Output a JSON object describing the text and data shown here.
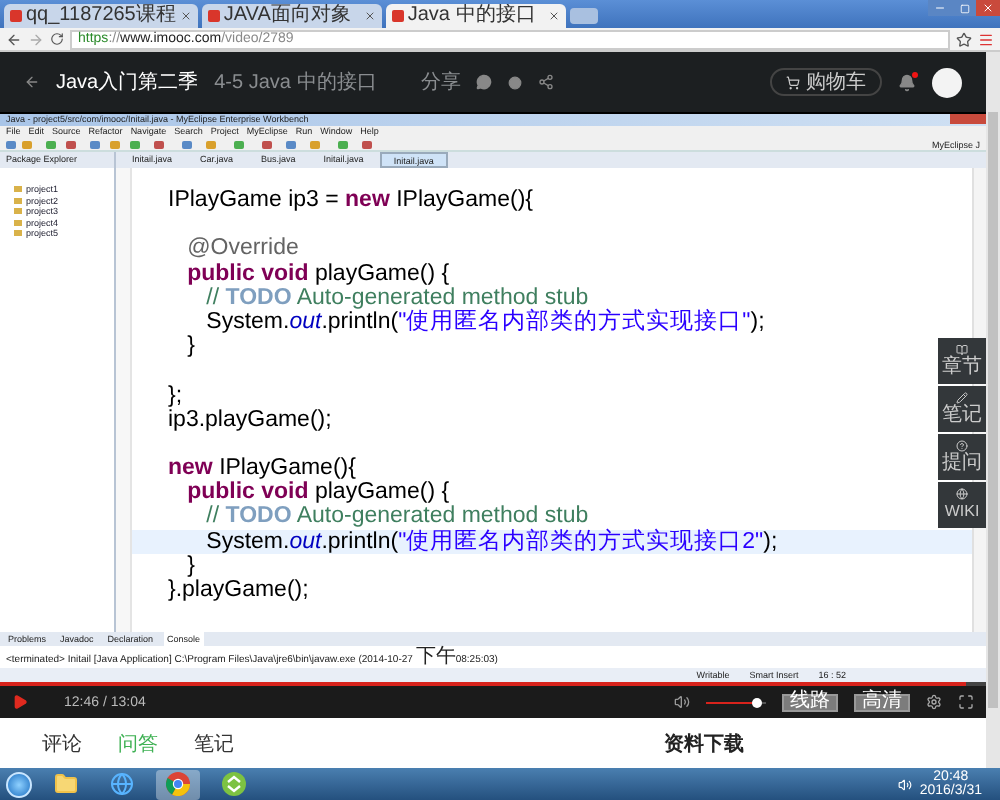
{
  "browser": {
    "tabs": [
      {
        "label": "qq_1187265课程",
        "selected": false
      },
      {
        "label": "JAVA面向对象",
        "selected": false
      },
      {
        "label": "Java 中的接口",
        "selected": true
      }
    ],
    "url": [
      {
        "kind": "scheme",
        "text": "https"
      },
      {
        "kind": "sep",
        "text": "://"
      },
      {
        "kind": "host",
        "text": "www.imooc.com"
      },
      {
        "kind": "path",
        "text": "/video/2789"
      }
    ]
  },
  "header": {
    "course": "Java入门第二季",
    "lesson": "4-5 Java 中的接口",
    "share": "分享",
    "cart": "购物车",
    "unread": true
  },
  "ide": {
    "title": "Java - project5/src/com/imooc/Initail.java - MyEclipse Enterprise Workbench",
    "menu": [
      "File",
      "Edit",
      "Source",
      "Refactor",
      "Navigate",
      "Search",
      "Project",
      "MyEclipse",
      "Run",
      "Window",
      "Help"
    ],
    "perspective": "MyEclipse J",
    "explorer": {
      "title": "Package Explorer",
      "items": [
        "project1",
        "project2",
        "project3",
        "project4",
        "project5"
      ]
    },
    "editor_tabs": [
      {
        "label": "Initail.java",
        "selected": false
      },
      {
        "label": "Car.java",
        "selected": false
      },
      {
        "label": "Bus.java",
        "selected": false
      },
      {
        "label": "Initail.java",
        "selected": false
      },
      {
        "label": "Initail.java",
        "selected": true
      }
    ],
    "code": [
      {
        "current": false,
        "tokens": [
          {
            "kind": "plain",
            "text": "IPlayGame ip3 = "
          },
          {
            "kind": "keyword",
            "text": "new"
          },
          {
            "kind": "plain",
            "text": " IPlayGame(){"
          }
        ]
      },
      {
        "current": false
      },
      {
        "current": false,
        "tokens": [
          {
            "kind": "annotation",
            "text": "   @Override"
          }
        ]
      },
      {
        "current": false,
        "tokens": [
          {
            "kind": "keyword",
            "text": "   public void"
          },
          {
            "kind": "plain",
            "text": " playGame() {"
          }
        ]
      },
      {
        "current": false,
        "tokens": [
          {
            "kind": "comment",
            "text": "      // "
          },
          {
            "kind": "todo",
            "text": "TODO"
          },
          {
            "kind": "comment",
            "text": " Auto-generated method stub"
          }
        ]
      },
      {
        "current": false,
        "tokens": [
          {
            "kind": "plain",
            "text": "      System."
          },
          {
            "kind": "field",
            "text": "out"
          },
          {
            "kind": "plain",
            "text": ".println("
          },
          {
            "kind": "string",
            "text": "\"使用匿名内部类的方式实现接口\""
          },
          {
            "kind": "plain",
            "text": ");"
          }
        ]
      },
      {
        "current": false,
        "tokens": [
          {
            "kind": "plain",
            "text": "   }"
          }
        ]
      },
      {
        "current": false
      },
      {
        "current": false,
        "tokens": [
          {
            "kind": "plain",
            "text": "};"
          }
        ]
      },
      {
        "current": false,
        "tokens": [
          {
            "kind": "plain",
            "text": "ip3.playGame();"
          }
        ]
      },
      {
        "current": false
      },
      {
        "current": false,
        "tokens": [
          {
            "kind": "keyword",
            "text": "new"
          },
          {
            "kind": "plain",
            "text": " IPlayGame(){"
          }
        ]
      },
      {
        "current": false,
        "tokens": [
          {
            "kind": "keyword",
            "text": "   public void"
          },
          {
            "kind": "plain",
            "text": " playGame() {"
          }
        ]
      },
      {
        "current": false,
        "tokens": [
          {
            "kind": "comment",
            "text": "      // "
          },
          {
            "kind": "todo",
            "text": "TODO"
          },
          {
            "kind": "comment",
            "text": " Auto-generated method stub"
          }
        ]
      },
      {
        "current": true,
        "tokens": [
          {
            "kind": "plain",
            "text": "      System."
          },
          {
            "kind": "field",
            "text": "out"
          },
          {
            "kind": "plain",
            "text": ".println("
          },
          {
            "kind": "string",
            "text": "\"使用匿名内部类的方式实现接口2\""
          },
          {
            "kind": "plain",
            "text": ");"
          }
        ]
      },
      {
        "current": false,
        "tokens": [
          {
            "kind": "plain",
            "text": "   }"
          }
        ]
      },
      {
        "current": false,
        "tokens": [
          {
            "kind": "plain",
            "text": "}.playGame();"
          }
        ]
      }
    ],
    "bottom_tabs": [
      {
        "label": "Problems",
        "selected": false
      },
      {
        "label": "Javadoc",
        "selected": false
      },
      {
        "label": "Declaration",
        "selected": false
      },
      {
        "label": "Console",
        "selected": true
      }
    ],
    "console": {
      "text": "<terminated> Initail [Java Application] C:\\Program Files\\Java\\jre6\\bin\\javaw.exe (2014-10-27 ",
      "cjk": "下午",
      "tail": "08:25:03)"
    },
    "status": [
      "Writable",
      "Smart Insert",
      "16 : 52"
    ]
  },
  "side_panel": [
    {
      "label": "章节"
    },
    {
      "label": "笔记"
    },
    {
      "label": "提问"
    },
    {
      "label": "WIKI"
    }
  ],
  "player": {
    "progress": {
      "level": 0.98
    },
    "time": "12:46 / 13:04",
    "line": "线路",
    "quality": "高清"
  },
  "page_tabs": [
    {
      "label": "评论",
      "selected": false
    },
    {
      "label": "问答",
      "selected": true
    },
    {
      "label": "笔记",
      "selected": false
    }
  ],
  "downloads": "资料下载",
  "taskbar": {
    "apps": [
      {
        "kind": "folder",
        "selected": false
      },
      {
        "kind": "ie",
        "selected": false
      },
      {
        "kind": "chrome",
        "selected": true
      },
      {
        "kind": "green",
        "selected": false
      }
    ],
    "time": "20:48",
    "date": "2016/3/31"
  }
}
